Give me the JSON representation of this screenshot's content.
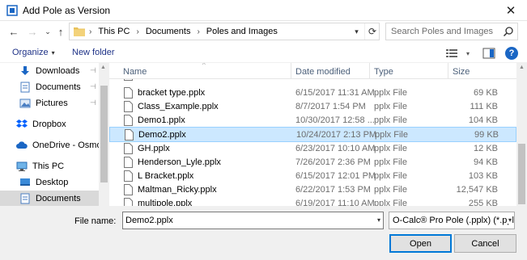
{
  "window": {
    "title": "Add Pole as Version",
    "close_glyph": "✕"
  },
  "nav": {
    "back_glyph": "←",
    "forward_glyph": "→",
    "recent_glyph": "⌄",
    "up_glyph": "↑",
    "breadcrumbs": [
      "This PC",
      "Documents",
      "Poles and Images"
    ],
    "crumb_sep": "›",
    "refresh_glyph": "⟳",
    "search_placeholder": "Search Poles and Images"
  },
  "toolbar": {
    "organize": "Organize",
    "new_folder": "New folder",
    "dropdown_glyph": "▾"
  },
  "sidebar": {
    "items": [
      {
        "label": "Downloads",
        "icon": "download-arrow-icon",
        "pinned": true
      },
      {
        "label": "Documents",
        "icon": "document-icon",
        "pinned": true
      },
      {
        "label": "Pictures",
        "icon": "pictures-icon",
        "pinned": true
      },
      {
        "label": "Dropbox",
        "icon": "dropbox-icon",
        "pinned": false
      },
      {
        "label": "OneDrive - Osmose",
        "icon": "cloud-icon",
        "pinned": false
      },
      {
        "label": "This PC",
        "icon": "computer-icon",
        "pinned": false
      },
      {
        "label": "Desktop",
        "icon": "desktop-icon",
        "pinned": false
      },
      {
        "label": "Documents",
        "icon": "document-icon",
        "pinned": false,
        "selected": true
      }
    ],
    "pin_glyph": "📌"
  },
  "columns": {
    "name": "Name",
    "date": "Date modified",
    "type": "Type",
    "size": "Size"
  },
  "files": [
    {
      "name": "bracket type.pplx",
      "date": "6/15/2017 11:31 AM",
      "type": "pplx File",
      "size": "69 KB"
    },
    {
      "name": "Class_Example.pplx",
      "date": "8/7/2017 1:54 PM",
      "type": "pplx File",
      "size": "111 KB"
    },
    {
      "name": "Demo1.pplx",
      "date": "10/30/2017 12:58 ...",
      "type": "pplx File",
      "size": "104 KB"
    },
    {
      "name": "Demo2.pplx",
      "date": "10/24/2017 2:13 PM",
      "type": "pplx File",
      "size": "99 KB",
      "selected": true
    },
    {
      "name": "GH.pplx",
      "date": "6/23/2017 10:10 AM",
      "type": "pplx File",
      "size": "12 KB"
    },
    {
      "name": "Henderson_Lyle.pplx",
      "date": "7/26/2017 2:36 PM",
      "type": "pplx File",
      "size": "94 KB"
    },
    {
      "name": "L Bracket.pplx",
      "date": "6/15/2017 12:01 PM",
      "type": "pplx File",
      "size": "103 KB"
    },
    {
      "name": "Maltman_Ricky.pplx",
      "date": "6/22/2017 1:53 PM",
      "type": "pplx File",
      "size": "12,547 KB"
    },
    {
      "name": "multipole.pplx",
      "date": "6/19/2017 11:10 AM",
      "type": "pplx File",
      "size": "255 KB"
    }
  ],
  "footer": {
    "file_name_label": "File name:",
    "file_name_value": "Demo2.pplx",
    "file_type_value": "O-Calc® Pro Pole (.pplx) (*.pplx)",
    "open_label": "Open",
    "cancel_label": "Cancel"
  },
  "colors": {
    "selection_bg": "#cce8ff",
    "selection_border": "#99d1ff",
    "accent": "#0078d7",
    "link_blue": "#1e3287"
  }
}
